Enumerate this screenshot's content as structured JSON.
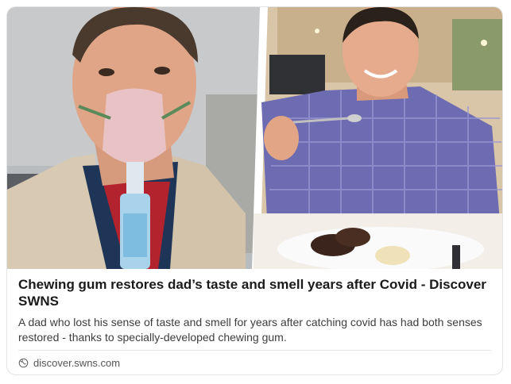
{
  "article": {
    "title": "Chewing gum restores dad’s taste and smell years after Covid - Discover SWNS",
    "description": "A dad who lost his sense of taste and smell for years after catching covid has had both senses restored - thanks to specially-developed chewing gum.",
    "source": "discover.swns.com"
  },
  "hero": {
    "left_photo": "man-with-oxygen-mask",
    "right_photo": "man-eating-dessert"
  },
  "icons": {
    "source_icon": "globe-icon"
  },
  "colors": {
    "title": "#1a1a1a",
    "description": "#3d3d3d",
    "source": "#555555",
    "border": "#e3e3e3"
  }
}
